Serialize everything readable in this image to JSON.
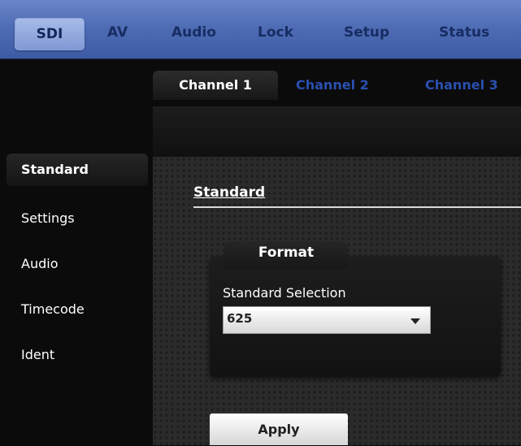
{
  "top_nav": {
    "tabs": [
      {
        "label": "SDI"
      },
      {
        "label": "AV"
      },
      {
        "label": "Audio"
      },
      {
        "label": "Lock"
      },
      {
        "label": "Setup"
      },
      {
        "label": "Status"
      }
    ]
  },
  "channel_tabs": [
    {
      "label": "Channel 1"
    },
    {
      "label": "Channel 2"
    },
    {
      "label": "Channel 3"
    }
  ],
  "sidebar": {
    "items": [
      {
        "label": "Standard"
      },
      {
        "label": "Settings"
      },
      {
        "label": "Audio"
      },
      {
        "label": "Timecode"
      },
      {
        "label": "Ident"
      }
    ]
  },
  "main": {
    "section_title": "Standard",
    "format_group": {
      "tab_label": "Format",
      "field_label": "Standard Selection",
      "select_value": "625"
    },
    "apply_label": "Apply"
  },
  "colors": {
    "nav_blue": "#4f6db5",
    "active_tab_blue": "#a8bce8",
    "channel_link_blue": "#2a4fb0"
  }
}
